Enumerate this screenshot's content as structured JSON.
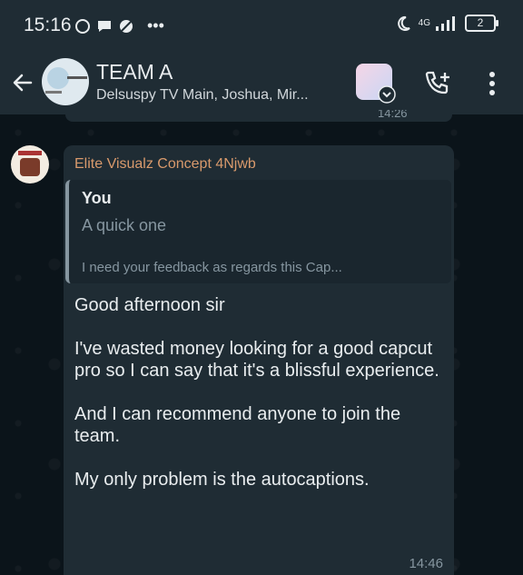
{
  "status_bar": {
    "time": "15:16",
    "network": "4G",
    "battery": "2"
  },
  "header": {
    "title": "TEAM A",
    "subtitle": "Delsuspy TV Main, Joshua, Mir..."
  },
  "previous_message": {
    "time": "14:26"
  },
  "message": {
    "sender": "Elite Visualz Concept 4Njwb",
    "quote": {
      "author": "You",
      "line1": "A quick one",
      "line2": "I need your feedback as regards this Cap..."
    },
    "paragraphs": [
      "Good afternoon sir",
      "I've wasted money looking for a good capcut pro so I can say that it's a blissful experience.",
      "And I can recommend anyone to join the team.",
      "My only problem is the autocaptions."
    ],
    "time": "14:46"
  }
}
